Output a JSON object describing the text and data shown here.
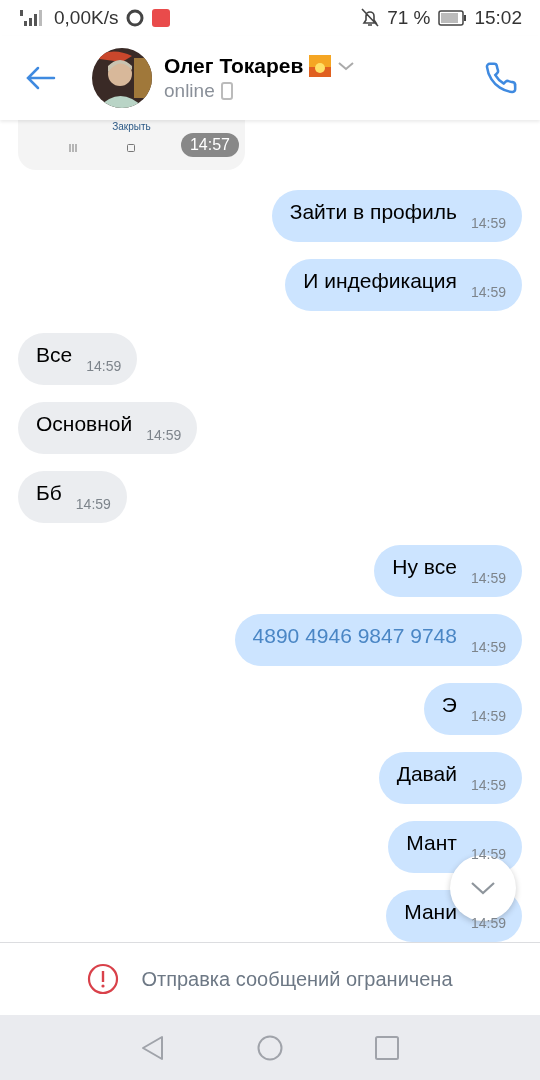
{
  "status_bar": {
    "speed": "0,00K/s",
    "battery": "71 %",
    "time": "15:02"
  },
  "header": {
    "name": "Олег Токарев",
    "status": "online"
  },
  "attachment": {
    "link": "Закрыть",
    "time": "14:57"
  },
  "messages": [
    {
      "kind": "text",
      "outgoing": true,
      "text": "Зайти в профиль",
      "time": "14:59"
    },
    {
      "kind": "text",
      "outgoing": true,
      "text": "И индефикация",
      "time": "14:59"
    },
    {
      "kind": "text",
      "outgoing": false,
      "text": "Все",
      "time": "14:59"
    },
    {
      "kind": "text",
      "outgoing": false,
      "text": "Основной",
      "time": "14:59"
    },
    {
      "kind": "text",
      "outgoing": false,
      "text": "Бб",
      "time": "14:59"
    },
    {
      "kind": "text",
      "outgoing": true,
      "text": "Ну все",
      "time": "14:59"
    },
    {
      "kind": "link",
      "outgoing": true,
      "text": "4890 4946 9847 9748",
      "time": "14:59"
    },
    {
      "kind": "text",
      "outgoing": true,
      "text": "Э",
      "time": "14:59"
    },
    {
      "kind": "text",
      "outgoing": true,
      "text": "Давай",
      "time": "14:59"
    },
    {
      "kind": "text",
      "outgoing": true,
      "text": "Мант",
      "time": "14:59"
    },
    {
      "kind": "text",
      "outgoing": true,
      "text": "Мани",
      "time": "14:59"
    }
  ],
  "notice": "Отправка сообщений ограничена"
}
